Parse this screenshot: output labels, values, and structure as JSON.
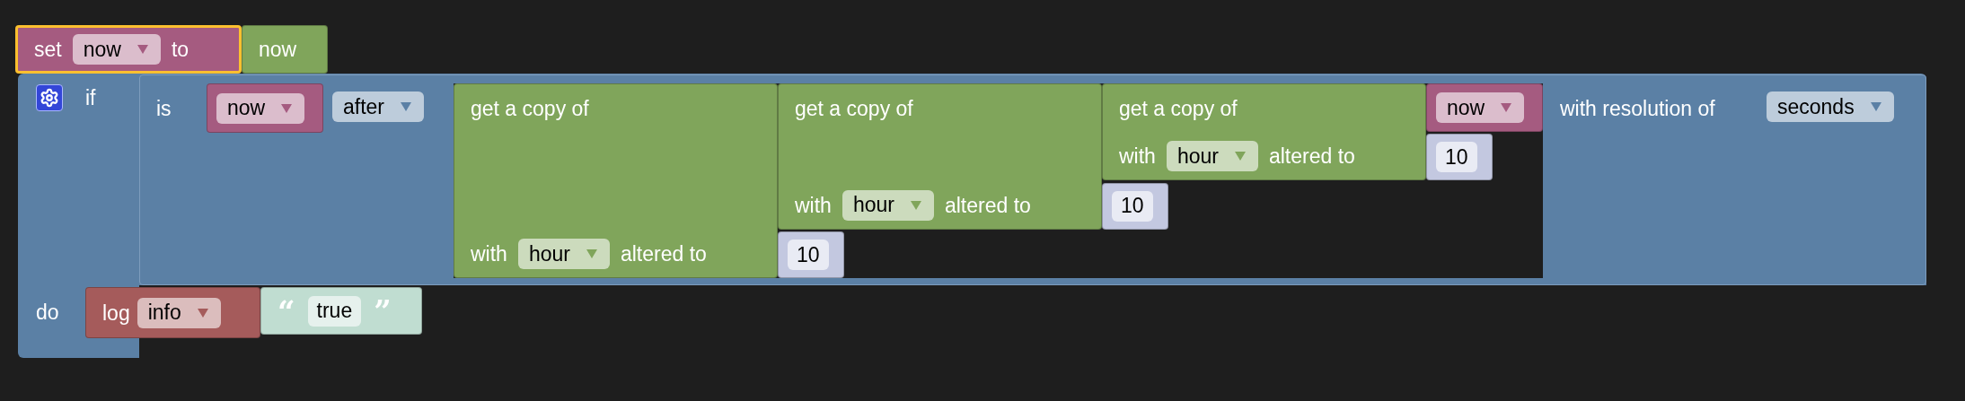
{
  "set_block": {
    "selected": true,
    "keyword": "set",
    "variable": "now",
    "connector": "to",
    "value": "now"
  },
  "if_block": {
    "selected": false,
    "keyword": "if",
    "do_keyword": "do",
    "condition": {
      "keyword": "is",
      "variable": "now",
      "operator": "after",
      "copies": [
        {
          "title": "get a copy of",
          "with": "with",
          "unit": "hour",
          "altered": "altered to",
          "amount": "10"
        },
        {
          "title": "get a copy of",
          "with": "with",
          "unit": "hour",
          "altered": "altered to",
          "amount": "10"
        },
        {
          "title": "get a copy of",
          "with": "with",
          "unit": "hour",
          "altered": "altered to",
          "amount": "10"
        }
      ],
      "innermost_variable": "now",
      "resolution_label": "with resolution of",
      "resolution": "seconds"
    },
    "do_statements": [
      {
        "kind": "log",
        "keyword": "log",
        "level": "info",
        "open_quote": "“",
        "text": "true",
        "close_quote": "”"
      }
    ]
  }
}
